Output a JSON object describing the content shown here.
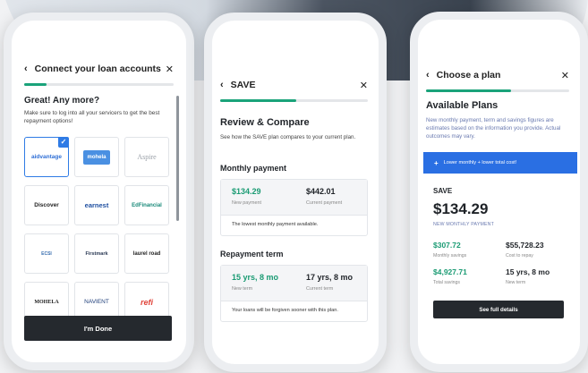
{
  "phone1": {
    "title": "Connect your loan accounts",
    "back_icon": "chevron-left-icon",
    "close_icon": "close-icon",
    "heading": "Great! Any more?",
    "subtext": "Make sure to log into all your servicers to get the best repayment options!",
    "servicers": [
      {
        "name": "aidvantage",
        "selected": true
      },
      {
        "name": "mohela",
        "selected": false
      },
      {
        "name": "Aspire",
        "selected": false
      },
      {
        "name": "Discover",
        "selected": false
      },
      {
        "name": "earnest",
        "selected": false
      },
      {
        "name": "EdFinancial",
        "selected": false
      },
      {
        "name": "ECSI",
        "selected": false
      },
      {
        "name": "Firstmark",
        "selected": false
      },
      {
        "name": "laurel road",
        "selected": false
      },
      {
        "name": "MOHELA",
        "selected": false
      },
      {
        "name": "NAVIENT",
        "selected": false
      },
      {
        "name": "refi",
        "selected": false
      }
    ],
    "done_label": "I'm Done"
  },
  "phone2": {
    "title": "SAVE",
    "heading": "Review & Compare",
    "subtext": "See how the SAVE plan compares to your current plan.",
    "monthly": {
      "title": "Monthly payment",
      "new_value": "$134.29",
      "new_label": "New payment",
      "current_value": "$442.01",
      "current_label": "Current payment",
      "note": "The lowest monthly payment available."
    },
    "term": {
      "title": "Repayment term",
      "new_value": "15 yrs, 8 mo",
      "new_label": "New term",
      "current_value": "17 yrs, 8 mo",
      "current_label": "Current term",
      "note": "Your loans will be forgiven sooner with this plan."
    }
  },
  "phone3": {
    "title": "Choose a plan",
    "heading": "Available Plans",
    "subtext": "New monthly payment, term and savings figures are estimates based on the information you provide. Actual outcomes may vary.",
    "banner": "Lower monthly + lower total cost!",
    "plan": {
      "name": "SAVE",
      "amount": "$134.29",
      "amount_caption": "NEW MONTHLY PAYMENT",
      "monthly_savings": "$307.72",
      "monthly_savings_label": "Monthly savings",
      "cost_to_repay": "$55,728.23",
      "cost_to_repay_label": "Cost to repay",
      "total_savings": "$4,927.71",
      "total_savings_label": "Total savings",
      "new_term": "15 yrs, 8 mo",
      "new_term_label": "New term"
    },
    "details_label": "See full details"
  },
  "colors": {
    "accent_green": "#1aa37a",
    "accent_blue": "#2a6fe3",
    "button_dark": "#25292e"
  }
}
